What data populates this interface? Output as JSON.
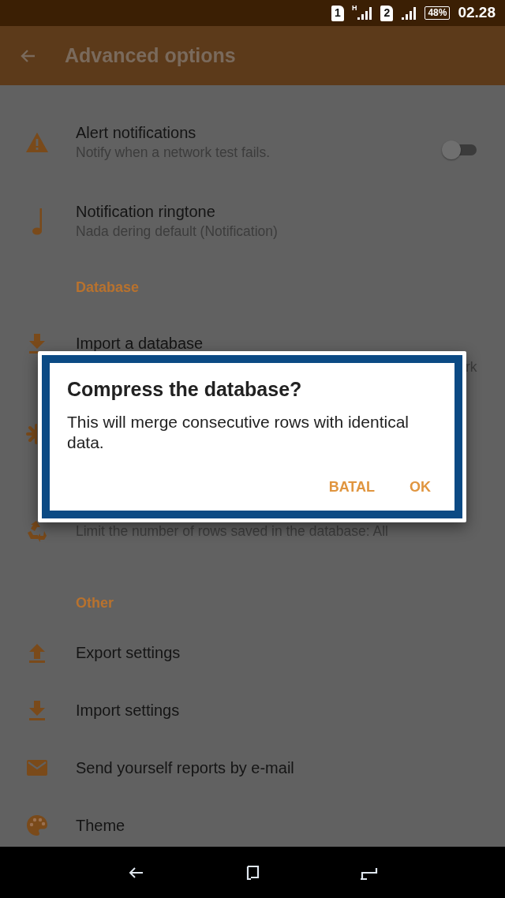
{
  "status_bar": {
    "sim_1": "1",
    "network_type": "H",
    "sim_2": "2",
    "battery": "48%",
    "time": "02.28"
  },
  "app_bar": {
    "title": "Advanced options"
  },
  "settings": [
    {
      "kind": "toggle",
      "title": "Alert notifications",
      "subtitle": "Notify when a network test fails.",
      "on": false
    },
    {
      "kind": "item",
      "title": "Notification ringtone",
      "subtitle": "Nada dering default (Notification)"
    },
    {
      "kind": "header",
      "title": "Database"
    },
    {
      "kind": "item",
      "title": "Import a database",
      "subtitle": "rk",
      "subtitle_cut": true
    },
    {
      "kind": "item"
    },
    {
      "kind": "item",
      "subtitle": "Limit the number of rows saved in the database: All"
    },
    {
      "kind": "header",
      "title": "Other"
    },
    {
      "kind": "item",
      "title": "Export settings"
    },
    {
      "kind": "item",
      "title": "Import settings"
    },
    {
      "kind": "item",
      "title": "Send yourself reports by e-mail"
    },
    {
      "kind": "item",
      "title": "Theme"
    }
  ],
  "dialog": {
    "title": "Compress the database?",
    "message": "This will merge consecutive rows with identical data.",
    "buttons": [
      "BATAL",
      "OK"
    ]
  }
}
